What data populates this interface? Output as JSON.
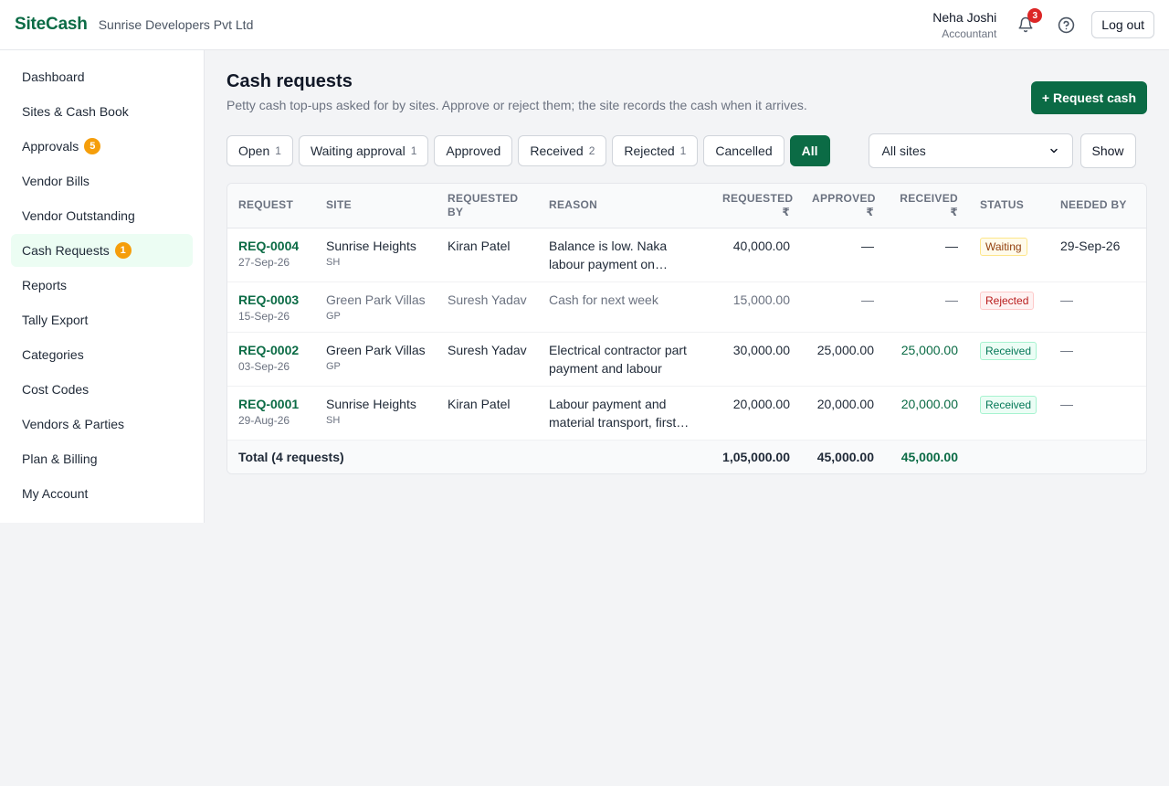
{
  "header": {
    "brand": "SiteCash",
    "company": "Sunrise Developers Pvt Ltd",
    "user_name": "Neha Joshi",
    "user_role": "Accountant",
    "notifications": "3",
    "logout_label": "Log out"
  },
  "sidebar": {
    "items": [
      {
        "label": "Dashboard",
        "badge": ""
      },
      {
        "label": "Sites & Cash Book",
        "badge": ""
      },
      {
        "label": "Approvals",
        "badge": "5"
      },
      {
        "label": "Vendor Bills",
        "badge": ""
      },
      {
        "label": "Vendor Outstanding",
        "badge": ""
      },
      {
        "label": "Cash Requests",
        "badge": "1"
      },
      {
        "label": "Reports",
        "badge": ""
      },
      {
        "label": "Tally Export",
        "badge": ""
      },
      {
        "label": "Categories",
        "badge": ""
      },
      {
        "label": "Cost Codes",
        "badge": ""
      },
      {
        "label": "Vendors & Parties",
        "badge": ""
      },
      {
        "label": "Plan & Billing",
        "badge": ""
      },
      {
        "label": "My Account",
        "badge": ""
      }
    ],
    "active": "Cash Requests"
  },
  "page": {
    "title": "Cash requests",
    "subtitle": "Petty cash top-ups asked for by sites. Approve or reject them; the site records the cash when it arrives.",
    "request_button": "+ Request cash"
  },
  "filters": {
    "chips": [
      {
        "label": "Open",
        "count": "1"
      },
      {
        "label": "Waiting approval",
        "count": "1"
      },
      {
        "label": "Approved",
        "count": ""
      },
      {
        "label": "Received",
        "count": "2"
      },
      {
        "label": "Rejected",
        "count": "1"
      },
      {
        "label": "Cancelled",
        "count": ""
      },
      {
        "label": "All",
        "count": ""
      }
    ],
    "active": "All",
    "site_select": "All sites",
    "show_label": "Show"
  },
  "table": {
    "columns": {
      "request": "Request",
      "site": "Site",
      "requested_by": "Requested by",
      "reason": "Reason",
      "requested": "Requested ₹",
      "approved": "Approved ₹",
      "received": "Received ₹",
      "status": "Status",
      "needed_by": "Needed by"
    },
    "rows": [
      {
        "id": "REQ-0004",
        "date": "27-Sep-26",
        "site": "Sunrise Heights",
        "site_code": "SH",
        "requested_by": "Kiran Patel",
        "reason": "Balance is low. Naka labour payment on Saturday and material",
        "requested": "40,000.00",
        "approved": "—",
        "received": "—",
        "status": "Waiting",
        "needed_by": "29-Sep-26"
      },
      {
        "id": "REQ-0003",
        "date": "15-Sep-26",
        "site": "Green Park Villas",
        "site_code": "GP",
        "requested_by": "Suresh Yadav",
        "reason": "Cash for next week",
        "requested": "15,000.00",
        "approved": "—",
        "received": "—",
        "status": "Rejected",
        "needed_by": "—"
      },
      {
        "id": "REQ-0002",
        "date": "03-Sep-26",
        "site": "Green Park Villas",
        "site_code": "GP",
        "requested_by": "Suresh Yadav",
        "reason": "Electrical contractor part payment and labour",
        "requested": "30,000.00",
        "approved": "25,000.00",
        "received": "25,000.00",
        "status": "Received",
        "needed_by": "—"
      },
      {
        "id": "REQ-0001",
        "date": "29-Aug-26",
        "site": "Sunrise Heights",
        "site_code": "SH",
        "requested_by": "Kiran Patel",
        "reason": "Labour payment and material transport, first week of site",
        "requested": "20,000.00",
        "approved": "20,000.00",
        "received": "20,000.00",
        "status": "Received",
        "needed_by": "—"
      }
    ],
    "total": {
      "label": "Total (4 requests)",
      "requested": "1,05,000.00",
      "approved": "45,000.00",
      "received": "45,000.00"
    }
  },
  "colors": {
    "brand": "#0b6b45",
    "badge": "#f59e0b",
    "alert": "#dc2626"
  }
}
